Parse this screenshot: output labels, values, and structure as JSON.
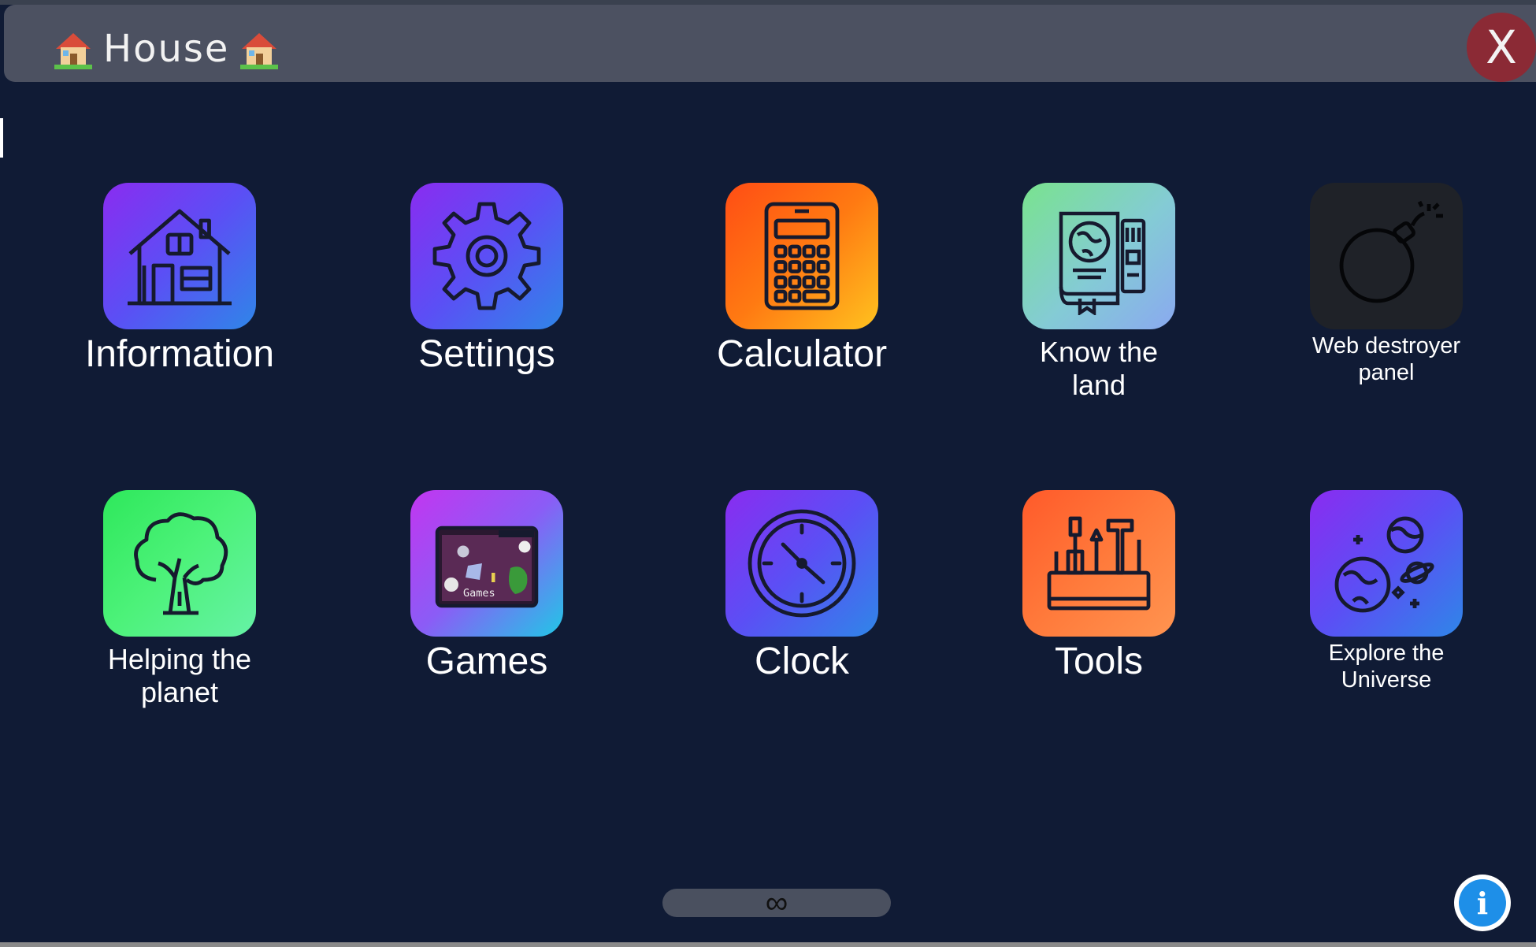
{
  "window": {
    "title": "House",
    "title_icon": "house-emoji",
    "close_label": "X"
  },
  "apps": [
    {
      "label": "Information",
      "icon": "house-icon",
      "colors": [
        "#8a2cf0",
        "#2f86e8"
      ]
    },
    {
      "label": "Settings",
      "icon": "gear-icon",
      "colors": [
        "#8a2cf0",
        "#2f86e8"
      ]
    },
    {
      "label": "Calculator",
      "icon": "calculator-icon",
      "colors": [
        "#ff4d14",
        "#ffc21f"
      ]
    },
    {
      "label": "Know the\nland",
      "icon": "atlas-book-icon",
      "colors": [
        "#79e38e",
        "#8aa9f0"
      ]
    },
    {
      "label": "Web destroyer\npanel",
      "icon": "bomb-icon",
      "colors": [
        "#1f2228",
        "#1f2228"
      ]
    },
    {
      "label": "Helping the\nplanet",
      "icon": "tree-icon",
      "colors": [
        "#2ee85b",
        "#66f2a6"
      ]
    },
    {
      "label": "Games",
      "icon": "games-folder-icon",
      "colors": [
        "#c236f0",
        "#21c7e6"
      ]
    },
    {
      "label": "Clock",
      "icon": "clock-icon",
      "colors": [
        "#8a2cf0",
        "#2f86e8"
      ]
    },
    {
      "label": "Tools",
      "icon": "toolbox-icon",
      "colors": [
        "#ff5a2a",
        "#ff9450"
      ]
    },
    {
      "label": "Explore the\nUniverse",
      "icon": "planets-icon",
      "colors": [
        "#8a2cf0",
        "#2f86e8"
      ]
    }
  ],
  "footer": {
    "scroll_symbol": "∞",
    "info_symbol": "i"
  }
}
